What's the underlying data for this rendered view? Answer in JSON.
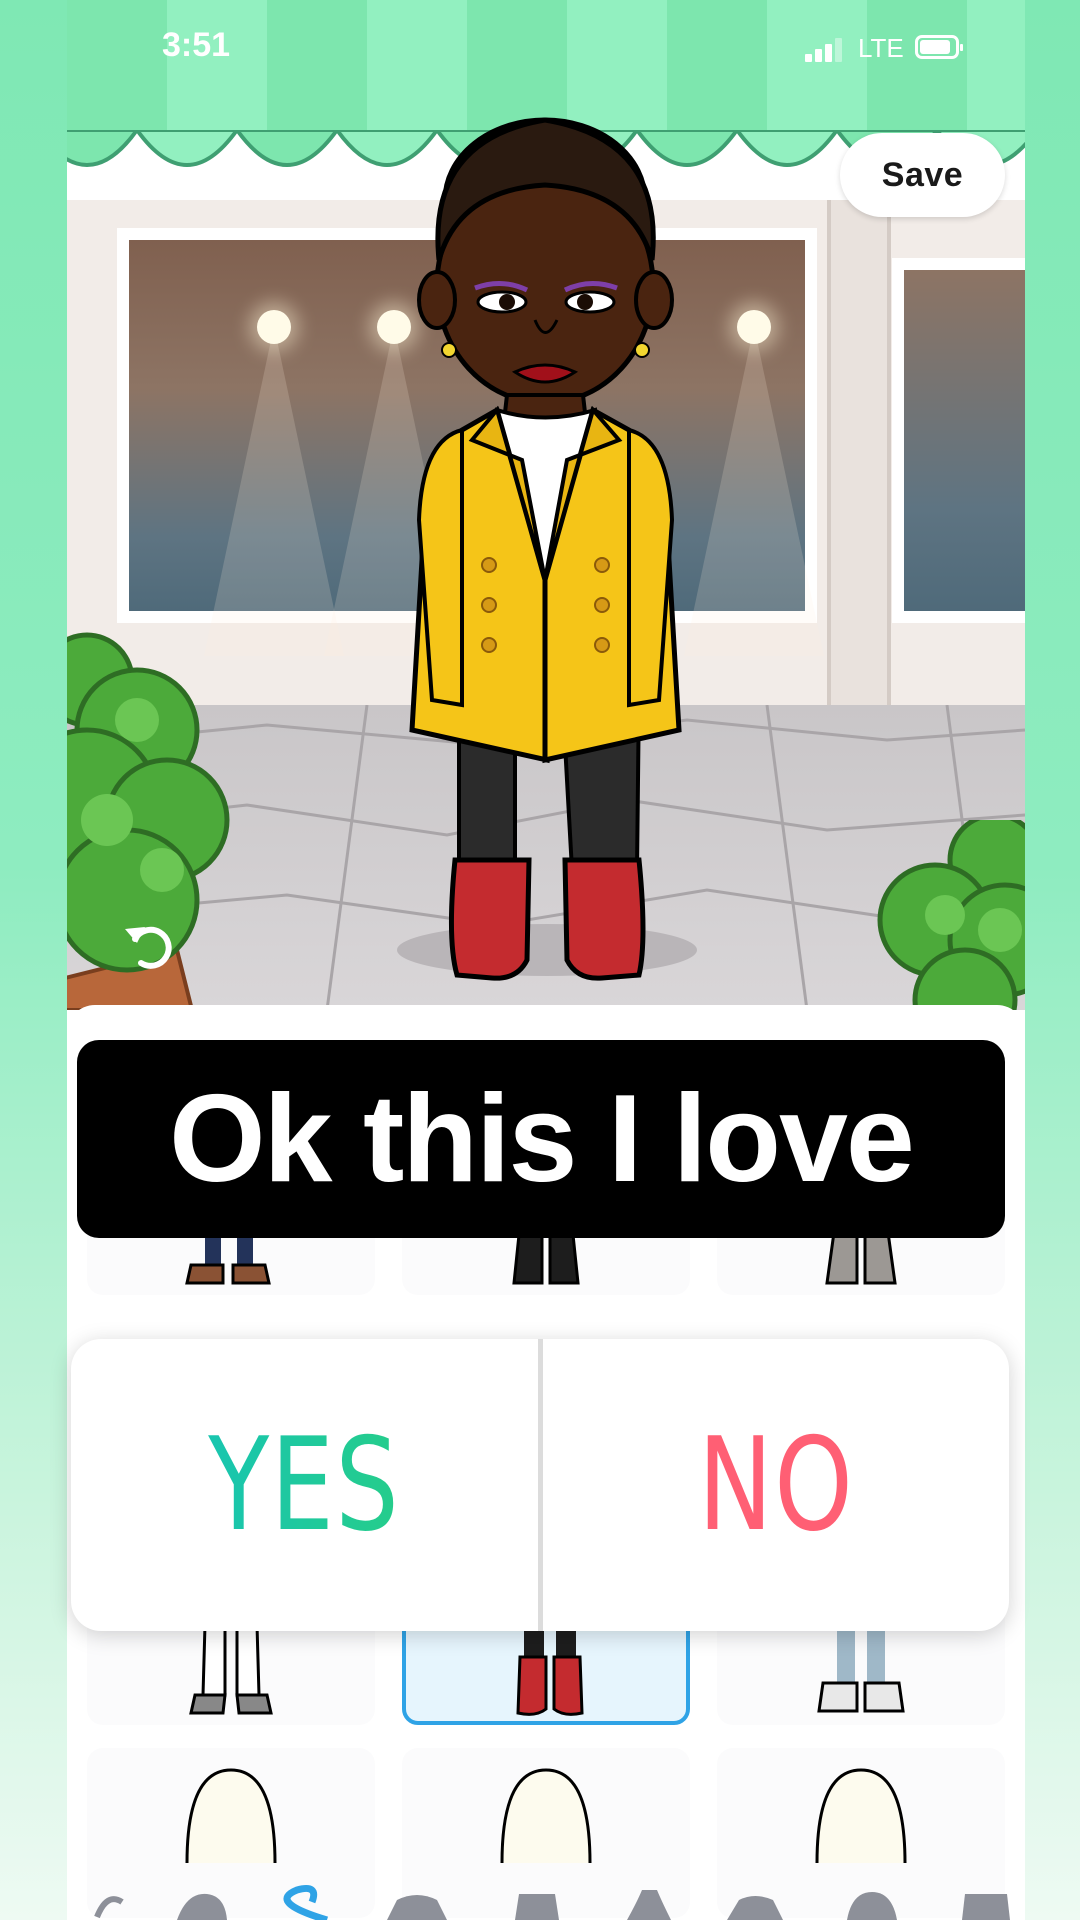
{
  "status_bar": {
    "time": "3:51",
    "network": "LTE",
    "signal_level": 3,
    "battery_level": 0.8
  },
  "header": {
    "close_icon": "close-icon",
    "save_label": "Save"
  },
  "scene": {
    "undo_icon": "undo-icon",
    "avatar": "avatar-character"
  },
  "sticker": {
    "caption": "Ok this I love"
  },
  "poll": {
    "yes_label": "YES",
    "no_label": "NO",
    "colors": {
      "yes_start": "#13c2c0",
      "yes_end": "#2bd07a",
      "no": "#ff5f74"
    }
  },
  "outfit_grid": {
    "selected_index": 4,
    "accent_color": "#2fa3e6",
    "items": [
      "shoes-brown",
      "boots-black",
      "boots-grey",
      "heels-white",
      "boots-red",
      "sneakers-white",
      "hoodie-1",
      "hoodie-2",
      "hoodie-3"
    ]
  },
  "tab_bar": {
    "icons": [
      "hanger-icon",
      "hat-icon",
      "shoe-icon",
      "shirt-icon",
      "pants-icon",
      "dress-icon",
      "jacket-icon",
      "bag-icon",
      "accessory-icon"
    ],
    "active_index": 2,
    "active_color": "#2fa3e6"
  }
}
